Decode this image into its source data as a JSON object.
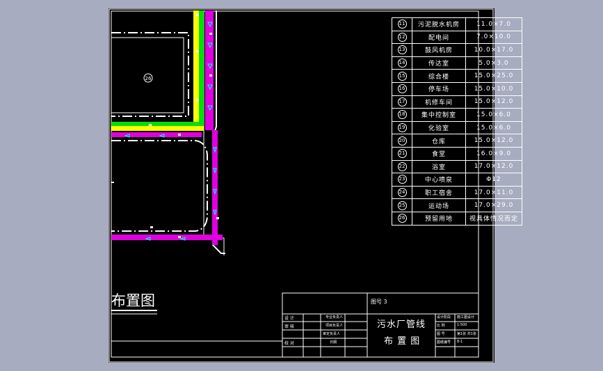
{
  "drawing": {
    "area_number": "26",
    "layout_label": "布置图",
    "colors": {
      "background": "#000000",
      "window": "#a8acc0",
      "line": "#ffffff",
      "pipe_magenta": "#e000e0",
      "pipe_yellow": "#ffff00",
      "pipe_green": "#00e000",
      "pipe_cyan": "#00ffff"
    }
  },
  "table": {
    "rows": [
      {
        "no": "11",
        "name": "污泥脱水机房",
        "size": "11.0×7.0"
      },
      {
        "no": "12",
        "name": "配电间",
        "size": "7.0×10.0"
      },
      {
        "no": "13",
        "name": "鼓风机房",
        "size": "10.0×17.0"
      },
      {
        "no": "14",
        "name": "传达室",
        "size": "5.0×3.0"
      },
      {
        "no": "15",
        "name": "综合楼",
        "size": "15.0×25.0"
      },
      {
        "no": "16",
        "name": "停车场",
        "size": "15.0×10.0"
      },
      {
        "no": "17",
        "name": "机修车间",
        "size": "15.0×12.0"
      },
      {
        "no": "18",
        "name": "集中控制室",
        "size": "15.0×6.0"
      },
      {
        "no": "19",
        "name": "化验室",
        "size": "15.0×6.0"
      },
      {
        "no": "20",
        "name": "仓库",
        "size": "15.0×12.0"
      },
      {
        "no": "21",
        "name": "食堂",
        "size": "16.0×9.0"
      },
      {
        "no": "22",
        "name": "浴室",
        "size": "17.0×12.0"
      },
      {
        "no": "23",
        "name": "中心喷泉",
        "size": "Φ12"
      },
      {
        "no": "24",
        "name": "职工宿舍",
        "size": "17.0×11.0"
      },
      {
        "no": "25",
        "name": "运动场",
        "size": "17.0×29.0"
      },
      {
        "no": "26",
        "name": "预留用地",
        "size": "视具体情况而定"
      }
    ]
  },
  "title_block": {
    "drawing_no": "图号 3",
    "left_labels": [
      "设 计",
      "审 核",
      "校 对"
    ],
    "mid_labels": [
      "专业负责人",
      "项目负责人",
      "审定负责人",
      "日期"
    ],
    "title_line1": "污水厂管线",
    "title_line2": "布 置 图",
    "right_labels": [
      {
        "k": "设计阶段",
        "v": "施工图设计"
      },
      {
        "k": "比 例",
        "v": "1:500"
      },
      {
        "k": "图 号",
        "v": "第1张 共1张"
      },
      {
        "k": "图纸编号",
        "v": "8-1"
      }
    ]
  }
}
